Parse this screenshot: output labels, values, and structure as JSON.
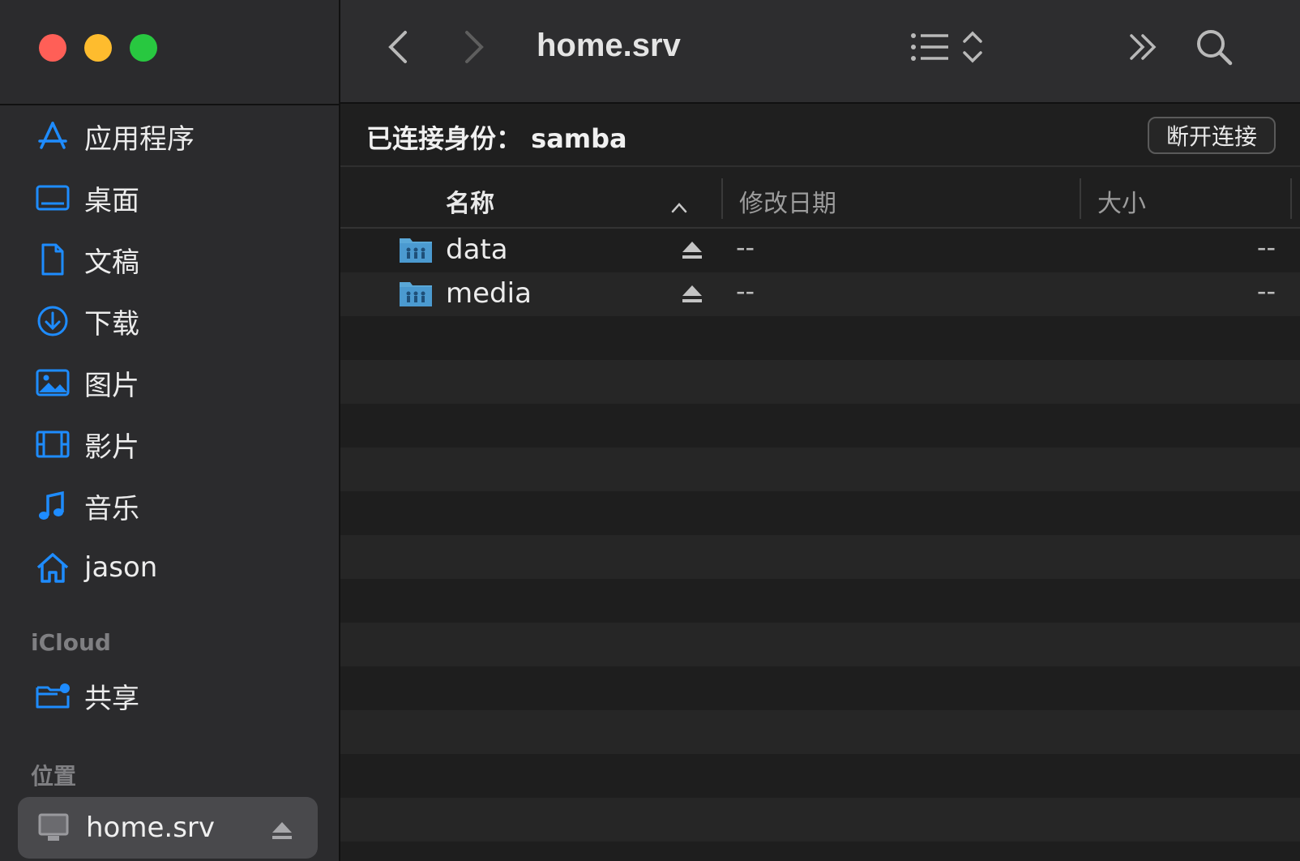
{
  "window": {
    "title": "home.srv"
  },
  "sidebar": {
    "favorites": [
      {
        "label": "应用程序",
        "icon": "applications-icon"
      },
      {
        "label": "桌面",
        "icon": "desktop-icon"
      },
      {
        "label": "文稿",
        "icon": "document-icon"
      },
      {
        "label": "下载",
        "icon": "download-icon"
      },
      {
        "label": "图片",
        "icon": "pictures-icon"
      },
      {
        "label": "影片",
        "icon": "movies-icon"
      },
      {
        "label": "音乐",
        "icon": "music-icon"
      },
      {
        "label": "jason",
        "icon": "home-icon"
      }
    ],
    "icloud_label": "iCloud",
    "icloud_items": [
      {
        "label": "共享",
        "icon": "shared-folder-icon"
      }
    ],
    "locations_label": "位置",
    "locations": [
      {
        "label": "home.srv",
        "icon": "computer-icon",
        "selected": true
      }
    ]
  },
  "connection": {
    "text": "已连接身份： samba",
    "disconnect_label": "断开连接"
  },
  "columns": {
    "name": "名称",
    "modified": "修改日期",
    "size": "大小",
    "sorted_by": "name",
    "sort_direction": "ascending"
  },
  "files": [
    {
      "name": "data",
      "modified": "--",
      "size": "--"
    },
    {
      "name": "media",
      "modified": "--",
      "size": "--"
    }
  ],
  "colors": {
    "accent": "#1e8cff",
    "sidebar_bg": "#2b2b2d",
    "selected_bg": "#49494c"
  }
}
